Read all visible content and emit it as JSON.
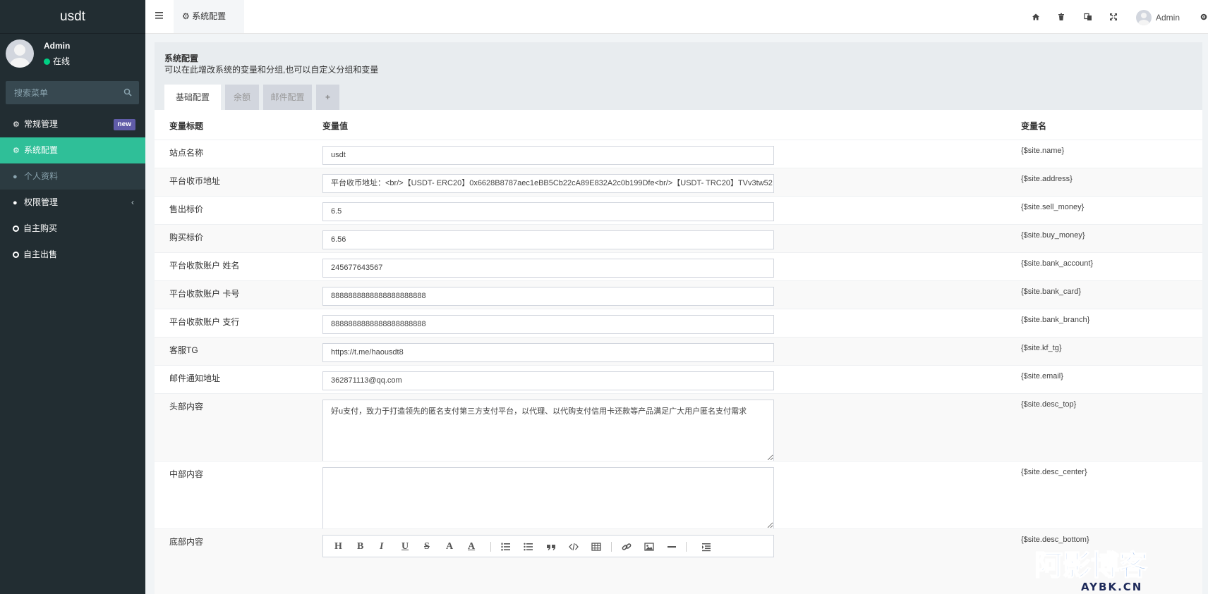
{
  "app": {
    "brand": "usdt",
    "user": {
      "name": "Admin",
      "status": "在线"
    },
    "search_placeholder": "搜索菜单"
  },
  "sidebar": {
    "items": [
      {
        "label": "常规管理",
        "icon": "gears-icon",
        "badge": "new"
      },
      {
        "label": "系统配置",
        "icon": "gear-icon",
        "active": true
      },
      {
        "label": "个人资料",
        "icon": "user-icon"
      },
      {
        "label": "权限管理",
        "icon": "users-icon"
      },
      {
        "label": "自主购买",
        "icon": "circle-icon"
      },
      {
        "label": "自主出售",
        "icon": "circle-icon"
      }
    ]
  },
  "topbar": {
    "tab_label": "系统配置",
    "user_label": "Admin",
    "icons": [
      "home-icon",
      "trash-icon",
      "language-icon",
      "fullscreen-icon",
      "settings-icon"
    ]
  },
  "page": {
    "title": "系统配置",
    "subtitle": "可以在此增改系统的变量和分组,也可以自定义分组和变量",
    "tabs": [
      "基础配置",
      "余额",
      "邮件配置",
      "+"
    ]
  },
  "table": {
    "headers": {
      "title": "变量标题",
      "value": "变量值",
      "name": "变量名"
    },
    "rows": [
      {
        "label": "站点名称",
        "value": "usdt",
        "var": "{$site.name}"
      },
      {
        "label": "平台收币地址",
        "value": "平台收币地址：<br/>【USDT- ERC20】0x6628B8787aec1eBB5Cb22cA89E832A2c0b199Dfe<br/>【USDT- TRC20】TVv3tw52",
        "var": "{$site.address}"
      },
      {
        "label": "售出标价",
        "value": "6.5",
        "var": "{$site.sell_money}"
      },
      {
        "label": "购买标价",
        "value": "6.56",
        "var": "{$site.buy_money}"
      },
      {
        "label": "平台收款账户 姓名",
        "value": "245677643567",
        "var": "{$site.bank_account}"
      },
      {
        "label": "平台收款账户 卡号",
        "value": "8888888888888888888888",
        "var": "{$site.bank_card}"
      },
      {
        "label": "平台收款账户 支行",
        "value": "8888888888888888888888",
        "var": "{$site.bank_branch}"
      },
      {
        "label": "客服TG",
        "value": "https://t.me/haousdt8",
        "var": "{$site.kf_tg}"
      },
      {
        "label": "邮件通知地址",
        "value": "362871113@qq.com",
        "var": "{$site.email}"
      },
      {
        "label": "头部内容",
        "value": "好u支付，致力于打造领先的匿名支付第三方支付平台，以代理、以代购支付信用卡还款等产品满足广大用户匿名支付需求",
        "var": "{$site.desc_top}"
      },
      {
        "label": "中部内容",
        "value": "",
        "var": "{$site.desc_center}"
      },
      {
        "label": "底部内容",
        "value": "",
        "var": "{$site.desc_bottom}"
      }
    ]
  },
  "editor": {
    "buttons": [
      "H",
      "B",
      "I",
      "U",
      "S",
      "A",
      "A"
    ]
  },
  "watermark": {
    "text": "阿影博客",
    "sub": "AYBK.CN"
  }
}
